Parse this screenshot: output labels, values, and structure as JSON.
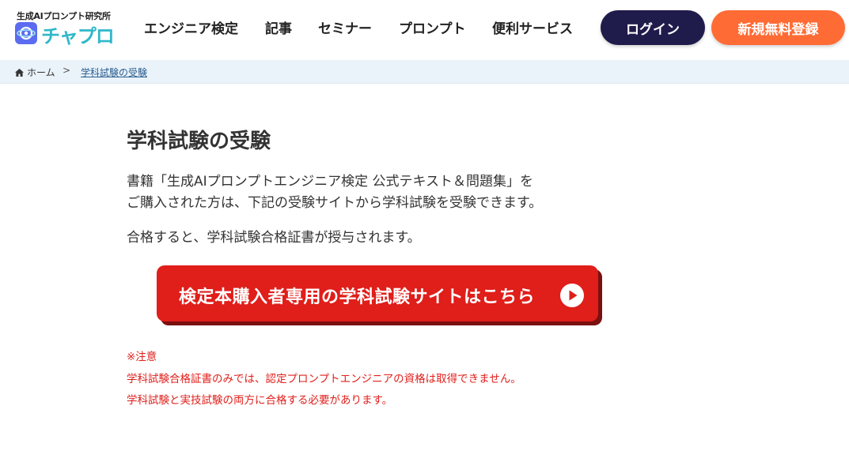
{
  "header": {
    "logo_tagline": "生成AIプロンプト研究所",
    "logo_name": "チャプロ",
    "nav": [
      {
        "label": "エンジニア検定"
      },
      {
        "label": "記事"
      },
      {
        "label": "セミナー"
      },
      {
        "label": "プロンプト"
      },
      {
        "label": "便利サービス"
      }
    ],
    "login_label": "ログイン",
    "register_label": "新規無料登録"
  },
  "breadcrumb": {
    "home": "ホーム",
    "separator": ">",
    "current": "学科試験の受験"
  },
  "main": {
    "title": "学科試験の受験",
    "paragraph1_line1": "書籍「生成AIプロンプトエンジニア検定 公式テキスト＆問題集」を",
    "paragraph1_line2": "ご購入された方は、下記の受験サイトから学科試験を受験できます。",
    "paragraph2": "合格すると、学科試験合格証書が授与されます。",
    "cta_label": "検定本購入者専用の学科試験サイトはこちら",
    "notes": {
      "heading": "※注意",
      "line1": "学科試験合格証書のみでは、認定プロンプトエンジニアの資格は取得できません。",
      "line2": "学科試験と実技試験の両方に合格する必要があります。"
    }
  },
  "colors": {
    "login_bg": "#1f1b4b",
    "register_bg": "#ff6b35",
    "cta_bg": "#e01e1a",
    "note_text": "#e0201c",
    "breadcrumb_bg": "#eaf3fa",
    "logo_accent": "#2fb8c9"
  },
  "icons": {
    "logo": "chapro-logo-icon",
    "home": "home-icon",
    "cta_arrow": "play-circle-icon"
  }
}
